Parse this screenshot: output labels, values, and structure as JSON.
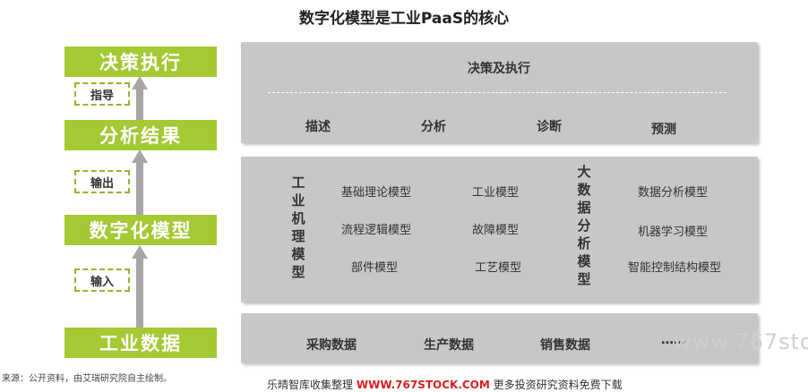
{
  "title": "数字化模型是工业PaaS的核心",
  "left_column": {
    "boxes": [
      "决策执行",
      "分析结果",
      "数字化模型",
      "工业数据"
    ],
    "connectors": [
      "指导",
      "输出",
      "输入"
    ]
  },
  "panel_top": {
    "heading": "决策及执行",
    "items": [
      "描述",
      "分析",
      "诊断",
      "预测"
    ]
  },
  "panel_mid": {
    "group1_label": "工业机理模型",
    "group1_col1": [
      "基础理论模型",
      "流程逻辑模型",
      "部件模型"
    ],
    "group1_col2": [
      "工业模型",
      "故障模型",
      "工艺模型"
    ],
    "group2_label": "大数据分析模型",
    "group2_col": [
      "数据分析模型",
      "机器学习模型",
      "智能控制结构模型"
    ]
  },
  "panel_bottom": {
    "items": [
      "采购数据",
      "生产数据",
      "销售数据",
      "……"
    ]
  },
  "source_note": "来源：公开资料，由艾瑞研究院自主绘制。",
  "footer": {
    "prefix": "乐晴智库收集整理",
    "url": "WWW.767STOCK.COM",
    "suffix": "更多投资研究资料免费下载"
  },
  "watermark": "www.767sto",
  "colors": {
    "accent_green": "#a3c933",
    "panel_gray": "#c7c7c7",
    "footer_url_red": "#d9201f"
  }
}
